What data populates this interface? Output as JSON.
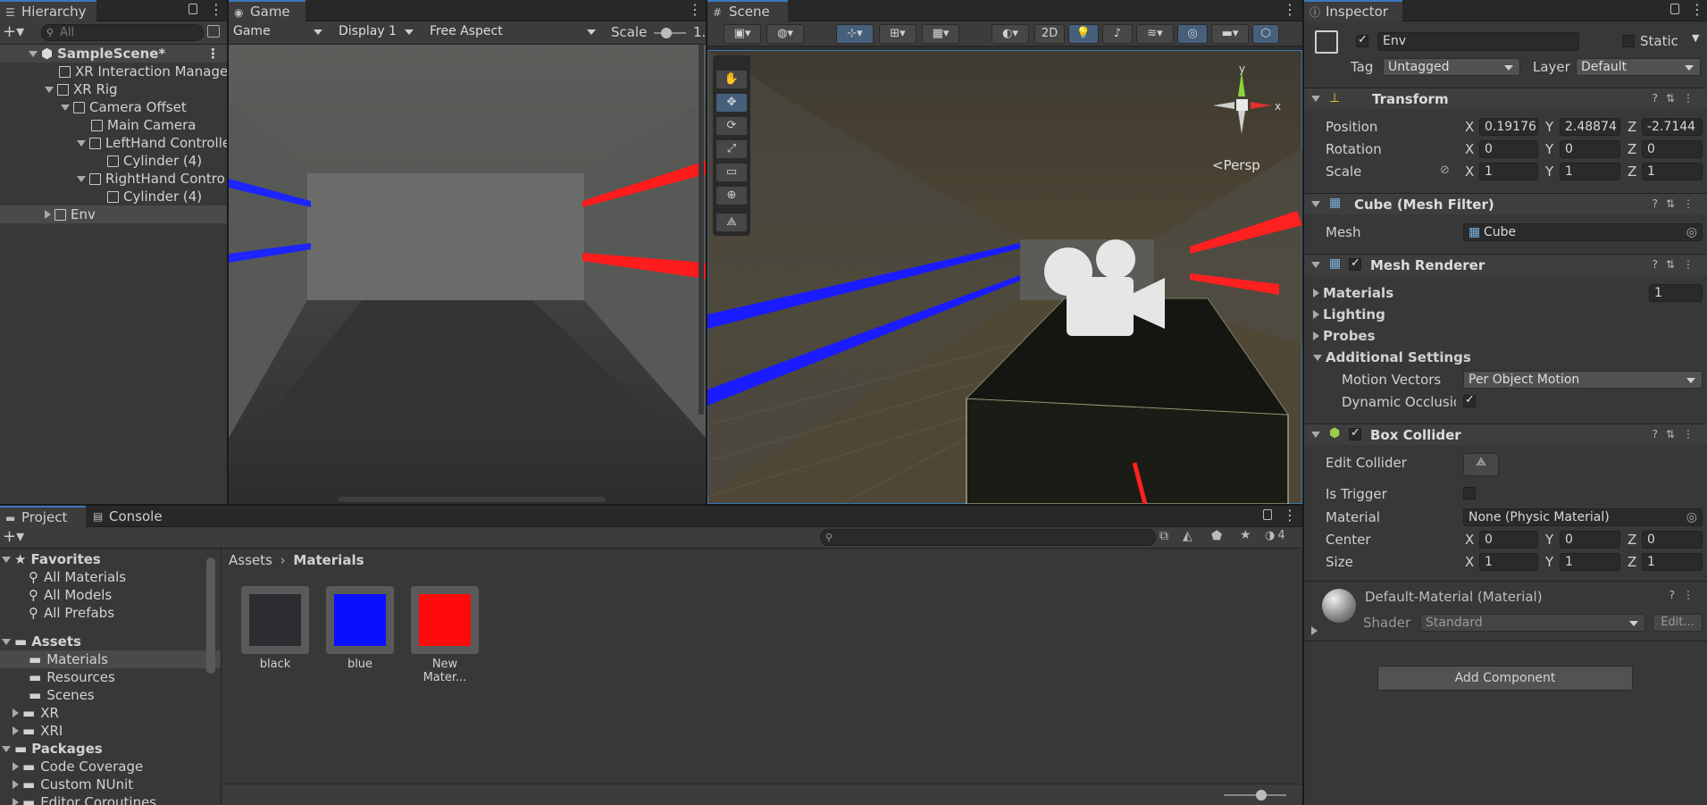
{
  "hierarchy": {
    "tab_label": "Hierarchy",
    "search_placeholder": "All",
    "items": [
      {
        "label": "SampleScene*",
        "indent": 0
      },
      {
        "label": "XR Interaction Manage",
        "indent": 1
      },
      {
        "label": "XR Rig",
        "indent": 1
      },
      {
        "label": "Camera Offset",
        "indent": 2
      },
      {
        "label": "Main Camera",
        "indent": 3
      },
      {
        "label": "LeftHand Controlle",
        "indent": 3
      },
      {
        "label": "Cylinder (4)",
        "indent": 4
      },
      {
        "label": "RightHand Contro",
        "indent": 3
      },
      {
        "label": "Cylinder (4)",
        "indent": 4
      },
      {
        "label": "Env",
        "indent": 1
      }
    ]
  },
  "game": {
    "tab_label": "Game",
    "mode": "Game",
    "display": "Display 1",
    "aspect": "Free Aspect",
    "scale_label": "Scale",
    "scale_value": "1."
  },
  "scene": {
    "tab_label": "Scene",
    "btn_2d": "2D",
    "persp_label": "<Persp",
    "gizmo_y": "y",
    "gizmo_x": "x"
  },
  "project": {
    "tab_label": "Project",
    "console_label": "Console",
    "breadcrumb_root": "Assets",
    "breadcrumb_current": "Materials",
    "hidden_count": "4",
    "favorites_label": "Favorites",
    "favorites": [
      "All Materials",
      "All Models",
      "All Prefabs"
    ],
    "assets_label": "Assets",
    "assets": [
      "Materials",
      "Resources",
      "Scenes",
      "XR",
      "XRI"
    ],
    "packages_label": "Packages",
    "packages": [
      "Code Coverage",
      "Custom NUnit",
      "Editor Coroutines"
    ],
    "materials": [
      {
        "name": "black",
        "color": "#2b2d30"
      },
      {
        "name": "blue",
        "color": "#0a10ff"
      },
      {
        "name": "New Mater...",
        "color": "#ff0a0a"
      }
    ]
  },
  "inspector": {
    "tab_label": "Inspector",
    "object_name": "Env",
    "static_label": "Static",
    "tag_label": "Tag",
    "tag_value": "Untagged",
    "layer_label": "Layer",
    "layer_value": "Default",
    "transform": {
      "title": "Transform",
      "position_label": "Position",
      "rotation_label": "Rotation",
      "scale_label": "Scale",
      "position": [
        "0.19176",
        "2.48874",
        "-2.7144"
      ],
      "rotation": [
        "0",
        "0",
        "0"
      ],
      "scale": [
        "1",
        "1",
        "1"
      ]
    },
    "mesh_filter": {
      "title": "Cube (Mesh Filter)",
      "mesh_label": "Mesh",
      "mesh_value": "Cube"
    },
    "mesh_renderer": {
      "title": "Mesh Renderer",
      "materials_label": "Materials",
      "materials_count": "1",
      "lighting_label": "Lighting",
      "probes_label": "Probes",
      "additional_label": "Additional Settings",
      "motion_label": "Motion Vectors",
      "motion_value": "Per Object Motion",
      "occlusion_label": "Dynamic Occlusion"
    },
    "box_collider": {
      "title": "Box Collider",
      "edit_label": "Edit Collider",
      "trigger_label": "Is Trigger",
      "material_label": "Material",
      "material_value": "None (Physic Material)",
      "center_label": "Center",
      "size_label": "Size",
      "center": [
        "0",
        "0",
        "0"
      ],
      "size": [
        "1",
        "1",
        "1"
      ]
    },
    "material": {
      "title": "Default-Material (Material)",
      "shader_label": "Shader",
      "shader_value": "Standard",
      "edit_label": "Edit..."
    },
    "add_component": "Add Component",
    "axis_x": "X",
    "axis_y": "Y",
    "axis_z": "Z"
  }
}
